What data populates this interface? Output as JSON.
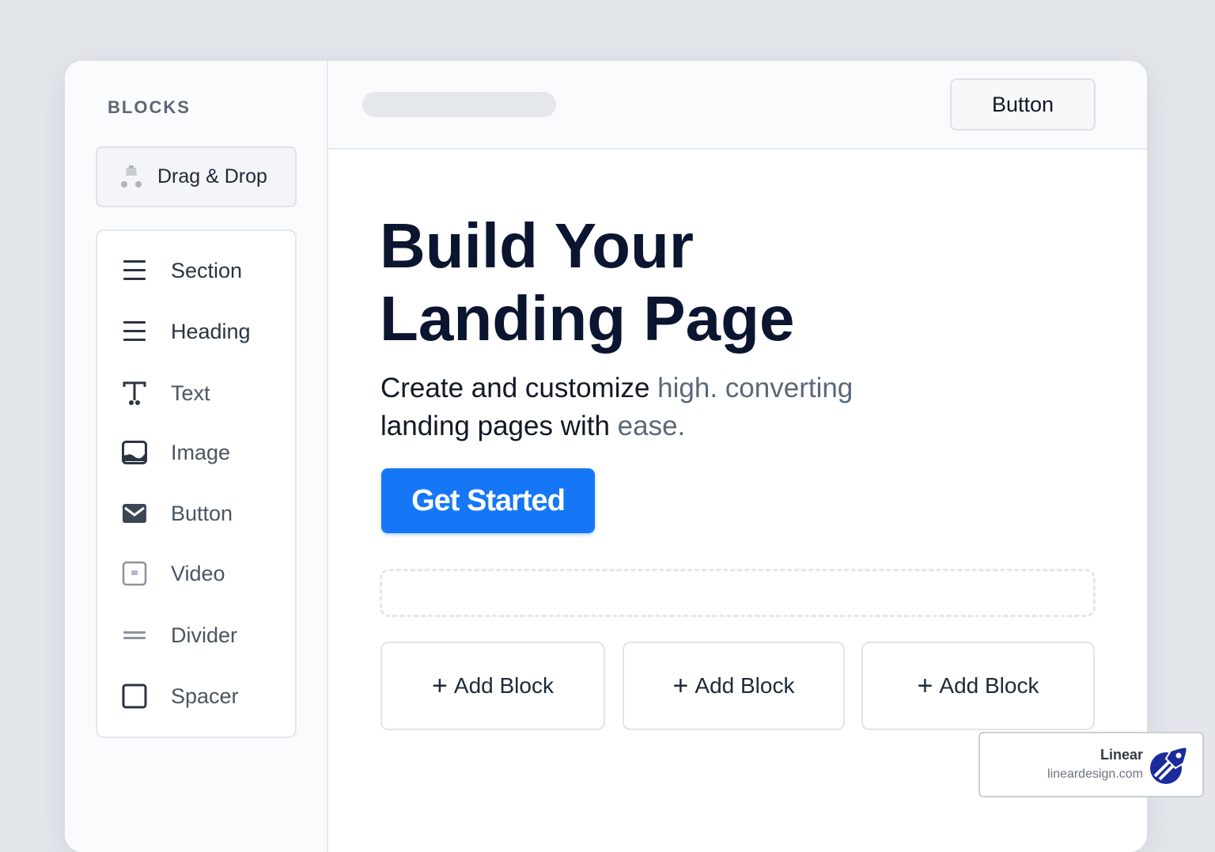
{
  "sidebar": {
    "title": "BLOCKS",
    "drag_drop": {
      "label": "Drag & Drop",
      "icon": "drag-drop-icon"
    },
    "items": [
      {
        "label": "Section",
        "icon": "section-icon"
      },
      {
        "label": "Heading",
        "icon": "heading-icon"
      },
      {
        "label": "Text",
        "icon": "text-icon"
      },
      {
        "label": "Image",
        "icon": "image-icon"
      },
      {
        "label": "Button",
        "icon": "button-icon"
      },
      {
        "label": "Video",
        "icon": "video-icon"
      },
      {
        "label": "Divider",
        "icon": "divider-icon"
      },
      {
        "label": "Spacer",
        "icon": "spacer-icon"
      }
    ]
  },
  "topbar": {
    "button_label": "Button"
  },
  "hero": {
    "title_line1": "Build Your",
    "title_line2": "Landing Page",
    "subtitle_a": "Create and customize ",
    "subtitle_b": "high. converting",
    "subtitle_c": "landing pages with ",
    "subtitle_d": "ease.",
    "cta_label": "Get Started"
  },
  "add_blocks": [
    {
      "label": "Add Block"
    },
    {
      "label": "Add Block"
    },
    {
      "label": "Add Block"
    }
  ],
  "badge": {
    "brand": "Linear",
    "site": "lineardesign.com"
  },
  "colors": {
    "accent": "#1677f6",
    "heading": "#0b1530",
    "background": "#e3e7ec"
  }
}
